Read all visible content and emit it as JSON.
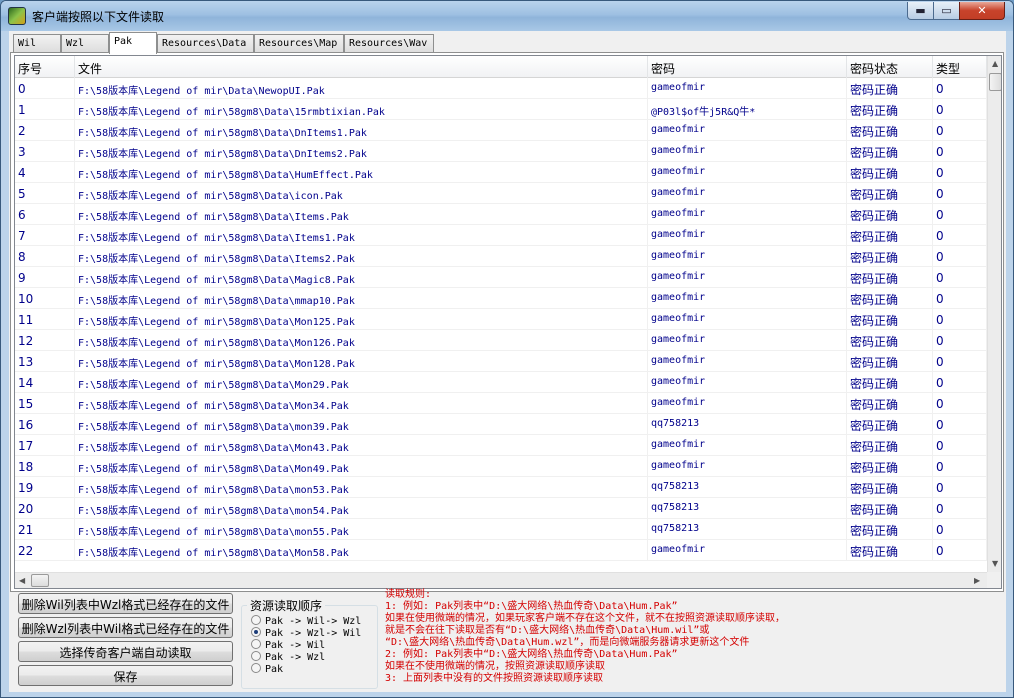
{
  "window": {
    "title": "客户端按照以下文件读取",
    "min_glyph": "▬",
    "max_glyph": "▭",
    "close_glyph": "✕"
  },
  "tabs": [
    "Wil",
    "Wzl",
    "Pak",
    "Resources\\Data",
    "Resources\\Map",
    "Resources\\Wav"
  ],
  "active_tab": "Pak",
  "table": {
    "columns": [
      "序号",
      "文件",
      "密码",
      "密码状态",
      "类型"
    ],
    "rows": [
      [
        "0",
        "F:\\58版本库\\Legend of mir\\Data\\NewopUI.Pak",
        "gameofmir",
        "密码正确",
        "0"
      ],
      [
        "1",
        "F:\\58版本库\\Legend of mir\\58gm8\\Data\\15rmbtixian.Pak",
        "@P03l$of牛j5R&Q牛*",
        "密码正确",
        "0"
      ],
      [
        "2",
        "F:\\58版本库\\Legend of mir\\58gm8\\Data\\DnItems1.Pak",
        "gameofmir",
        "密码正确",
        "0"
      ],
      [
        "3",
        "F:\\58版本库\\Legend of mir\\58gm8\\Data\\DnItems2.Pak",
        "gameofmir",
        "密码正确",
        "0"
      ],
      [
        "4",
        "F:\\58版本库\\Legend of mir\\58gm8\\Data\\HumEffect.Pak",
        "gameofmir",
        "密码正确",
        "0"
      ],
      [
        "5",
        "F:\\58版本库\\Legend of mir\\58gm8\\Data\\icon.Pak",
        "gameofmir",
        "密码正确",
        "0"
      ],
      [
        "6",
        "F:\\58版本库\\Legend of mir\\58gm8\\Data\\Items.Pak",
        "gameofmir",
        "密码正确",
        "0"
      ],
      [
        "7",
        "F:\\58版本库\\Legend of mir\\58gm8\\Data\\Items1.Pak",
        "gameofmir",
        "密码正确",
        "0"
      ],
      [
        "8",
        "F:\\58版本库\\Legend of mir\\58gm8\\Data\\Items2.Pak",
        "gameofmir",
        "密码正确",
        "0"
      ],
      [
        "9",
        "F:\\58版本库\\Legend of mir\\58gm8\\Data\\Magic8.Pak",
        "gameofmir",
        "密码正确",
        "0"
      ],
      [
        "10",
        "F:\\58版本库\\Legend of mir\\58gm8\\Data\\mmap10.Pak",
        "gameofmir",
        "密码正确",
        "0"
      ],
      [
        "11",
        "F:\\58版本库\\Legend of mir\\58gm8\\Data\\Mon125.Pak",
        "gameofmir",
        "密码正确",
        "0"
      ],
      [
        "12",
        "F:\\58版本库\\Legend of mir\\58gm8\\Data\\Mon126.Pak",
        "gameofmir",
        "密码正确",
        "0"
      ],
      [
        "13",
        "F:\\58版本库\\Legend of mir\\58gm8\\Data\\Mon128.Pak",
        "gameofmir",
        "密码正确",
        "0"
      ],
      [
        "14",
        "F:\\58版本库\\Legend of mir\\58gm8\\Data\\Mon29.Pak",
        "gameofmir",
        "密码正确",
        "0"
      ],
      [
        "15",
        "F:\\58版本库\\Legend of mir\\58gm8\\Data\\Mon34.Pak",
        "gameofmir",
        "密码正确",
        "0"
      ],
      [
        "16",
        "F:\\58版本库\\Legend of mir\\58gm8\\Data\\mon39.Pak",
        "qq758213",
        "密码正确",
        "0"
      ],
      [
        "17",
        "F:\\58版本库\\Legend of mir\\58gm8\\Data\\Mon43.Pak",
        "gameofmir",
        "密码正确",
        "0"
      ],
      [
        "18",
        "F:\\58版本库\\Legend of mir\\58gm8\\Data\\Mon49.Pak",
        "gameofmir",
        "密码正确",
        "0"
      ],
      [
        "19",
        "F:\\58版本库\\Legend of mir\\58gm8\\Data\\mon53.Pak",
        "qq758213",
        "密码正确",
        "0"
      ],
      [
        "20",
        "F:\\58版本库\\Legend of mir\\58gm8\\Data\\mon54.Pak",
        "qq758213",
        "密码正确",
        "0"
      ],
      [
        "21",
        "F:\\58版本库\\Legend of mir\\58gm8\\Data\\mon55.Pak",
        "qq758213",
        "密码正确",
        "0"
      ],
      [
        "22",
        "F:\\58版本库\\Legend of mir\\58gm8\\Data\\Mon58.Pak",
        "gameofmir",
        "密码正确",
        "0"
      ]
    ]
  },
  "buttons": {
    "delete_wil": "删除Wil列表中Wzl格式已经存在的文件",
    "delete_wzl": "删除Wzl列表中Wil格式已经存在的文件",
    "select_client": "选择传奇客户端自动读取",
    "save": "保存"
  },
  "read_order": {
    "title": "资源读取顺序",
    "options": [
      "Pak -> Wil-> Wzl",
      "Pak -> Wzl-> Wil",
      "Pak -> Wil",
      "Pak -> Wzl",
      "Pak"
    ],
    "selected_index": 1
  },
  "rules": [
    "读取规则:",
    "1: 例如: Pak列表中“D:\\盛大网络\\热血传奇\\Data\\Hum.Pak”",
    "    如果在使用微端的情况，如果玩家客户端不存在这个文件，就不在按照资源读取顺序读取，",
    "    就是不会在往下读取是否有“D:\\盛大网络\\热血传奇\\Data\\Hum.wil”或",
    "  “D:\\盛大网络\\热血传奇\\Data\\Hum.wzl”，而是向微端服务器请求更新这个文件",
    "2: 例如: Pak列表中“D:\\盛大网络\\热血传奇\\Data\\Hum.Pak”",
    "    如果在不使用微端的情况，按照资源读取顺序读取",
    "3: 上面列表中没有的文件按照资源读取顺序读取"
  ]
}
